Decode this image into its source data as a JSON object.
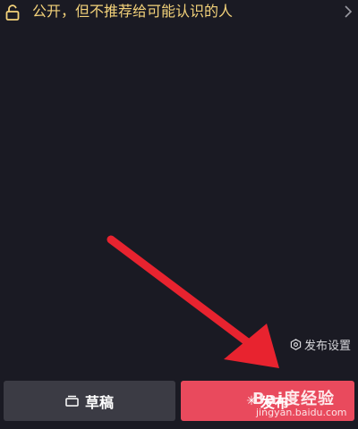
{
  "privacy": {
    "text": "公开，但不推荐给可能认识的人",
    "icon": "unlock-icon",
    "chevron_icon": "chevron-right-icon",
    "text_color": "#f3d27a"
  },
  "publish_settings": {
    "label": "发布设置",
    "icon": "settings-hexagon-icon"
  },
  "buttons": {
    "draft_label": "草稿",
    "draft_icon": "draft-box-icon",
    "publish_label": "发布",
    "publish_icon": "sparkle-icon",
    "publish_color": "#e94a5d",
    "draft_color": "#3b3b44"
  },
  "watermark": {
    "brand": "Bai度经验",
    "url": "jingyan.baidu.com"
  },
  "annotation": {
    "arrow_color": "#e8232f"
  }
}
